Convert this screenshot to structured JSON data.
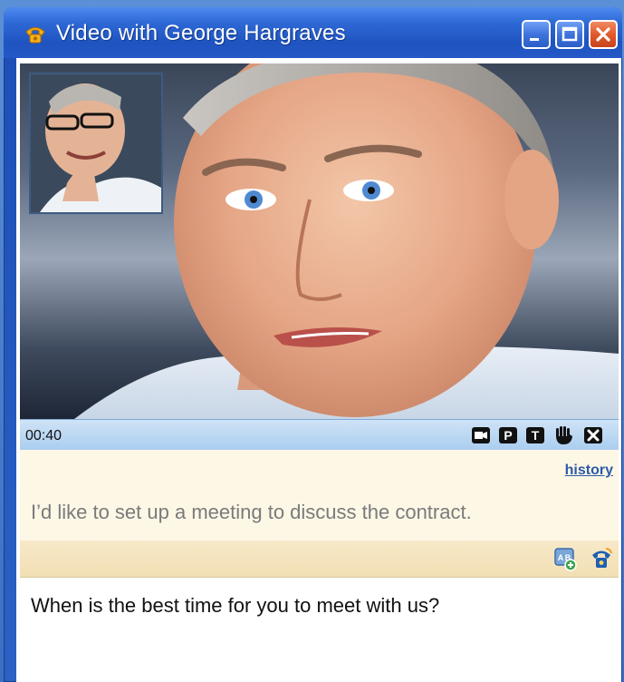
{
  "window": {
    "title": "Video with George Hargraves",
    "icons": {
      "app": "phone-handset-icon",
      "minimize": "minimize-icon",
      "maximize": "maximize-icon",
      "close": "close-icon"
    },
    "colors": {
      "titlebar": "#2e69d6",
      "close_button": "#e05a2c"
    }
  },
  "video": {
    "remote_feed": "remote-video-feed",
    "self_view": "self-view-thumbnail"
  },
  "controls": {
    "timer": "00:40",
    "buttons": [
      {
        "name": "video-camera-icon",
        "glyph": "▭"
      },
      {
        "name": "p-button-icon",
        "glyph": "P"
      },
      {
        "name": "t-button-icon",
        "glyph": "T"
      },
      {
        "name": "hand-icon",
        "glyph": "✋"
      },
      {
        "name": "end-call-icon",
        "glyph": "✕"
      }
    ]
  },
  "chat": {
    "history_link": "history",
    "received_message": "I’d like to set up a meeting to discuss the contract."
  },
  "input_toolbar": {
    "icons": [
      "translate-icon",
      "phone-icon"
    ]
  },
  "compose": {
    "text": "When is the best time for you to meet with us?"
  }
}
